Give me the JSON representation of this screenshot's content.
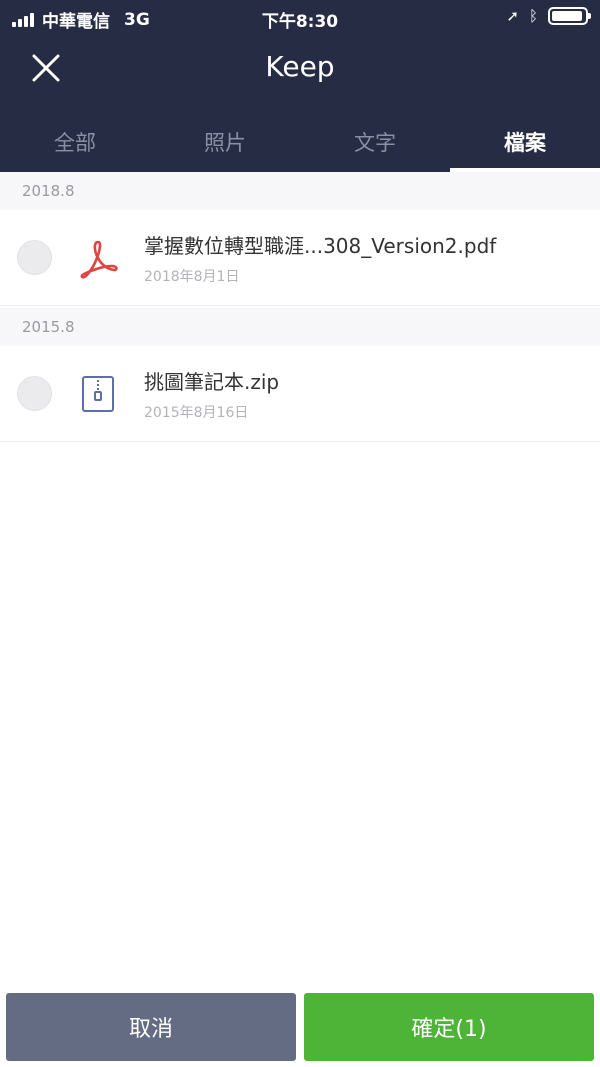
{
  "status_bar": {
    "carrier": "中華電信",
    "network": "3G",
    "time": "下午8:30",
    "location_icon": "location-arrow-icon",
    "bluetooth_icon": "bluetooth-icon",
    "battery_level": 0.95
  },
  "header": {
    "title": "Keep",
    "close_icon": "close-icon"
  },
  "tabs": [
    {
      "label": "全部",
      "active": false
    },
    {
      "label": "照片",
      "active": false
    },
    {
      "label": "文字",
      "active": false
    },
    {
      "label": "檔案",
      "active": true
    }
  ],
  "sections": [
    {
      "date_label": "2018.8",
      "files": [
        {
          "name": "掌握數位轉型職涯...308_Version2.pdf",
          "date": "2018年8月1日",
          "icon": "pdf-icon",
          "selected": false
        }
      ]
    },
    {
      "date_label": "2015.8",
      "files": [
        {
          "name": "挑圖筆記本.zip",
          "date": "2015年8月16日",
          "icon": "zip-icon",
          "selected": false
        }
      ]
    }
  ],
  "footer": {
    "cancel_label": "取消",
    "confirm_label": "確定(1)"
  },
  "colors": {
    "header_bg": "#262c43",
    "cancel_bg": "#646c84",
    "confirm_bg": "#4db437",
    "pdf_red": "#e0443e",
    "zip_blue": "#5d6ea8"
  }
}
